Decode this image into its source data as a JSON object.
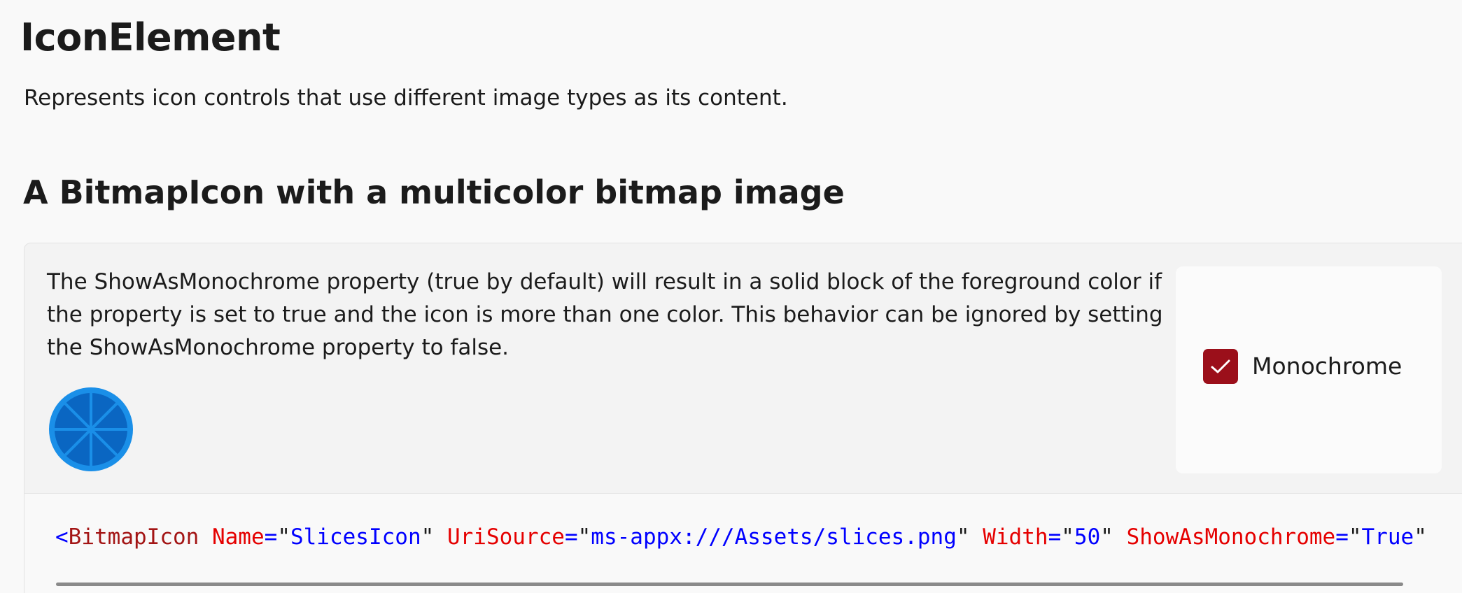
{
  "page": {
    "title": "IconElement",
    "description": "Represents icon controls that use different image types as its content."
  },
  "section": {
    "heading": "A BitmapIcon with a multicolor bitmap image"
  },
  "example": {
    "description": "The ShowAsMonochrome property (true by default) will result in a solid block of the foreground color if the property is set to true and the icon is more than one color. This behavior can be ignored by setting the ShowAsMonochrome property to false.",
    "icon": "slices-icon",
    "options": {
      "monochrome_checkbox": {
        "label": "Monochrome",
        "checked": true,
        "color": "#9b0f1a"
      }
    },
    "code": {
      "open": "<",
      "element": "BitmapIcon",
      "attributes": [
        {
          "name": "Name",
          "value": "SlicesIcon"
        },
        {
          "name": "UriSource",
          "value": "ms-appx:///Assets/slices.png"
        },
        {
          "name": "Width",
          "value": "50"
        },
        {
          "name": "ShowAsMonochrome",
          "value": "True"
        }
      ]
    }
  }
}
